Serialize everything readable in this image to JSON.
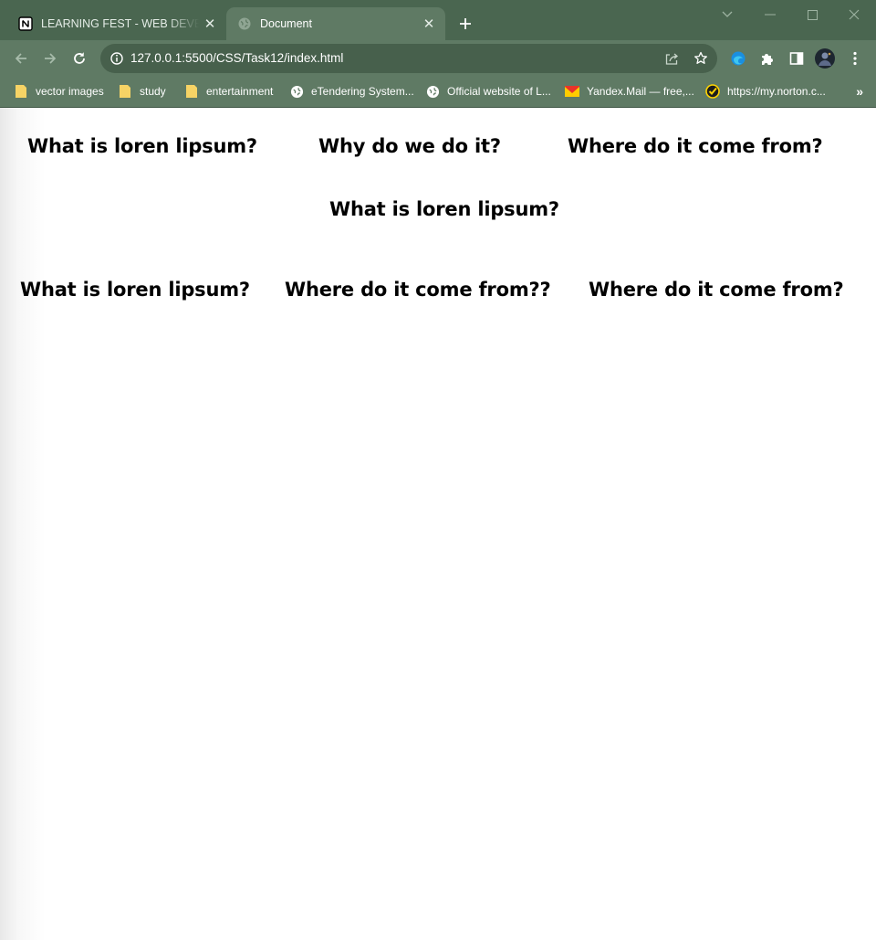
{
  "browser": {
    "tabs": [
      {
        "title": "LEARNING FEST - WEB DEVELOPMENT",
        "icon": "notion-icon",
        "active": false
      },
      {
        "title": "Document",
        "icon": "globe-icon",
        "active": true
      }
    ],
    "address": "127.0.0.1:5500/CSS/Task12/index.html",
    "bookmarks": [
      {
        "label": "vector images",
        "icon": "folder-icon"
      },
      {
        "label": "study",
        "icon": "folder-icon"
      },
      {
        "label": "entertainment",
        "icon": "folder-icon"
      },
      {
        "label": "eTendering System...",
        "icon": "globe-icon"
      },
      {
        "label": "Official website of L...",
        "icon": "globe-icon"
      },
      {
        "label": "Yandex.Mail — free,...",
        "icon": "mail-icon"
      },
      {
        "label": "https://my.norton.c...",
        "icon": "norton-icon"
      }
    ],
    "more_bookmarks": "»",
    "colors": {
      "frame": "#4a6650",
      "toolbar": "#5f7a64",
      "omnibox": "#47604c"
    }
  },
  "page": {
    "row1": [
      "What is loren lipsum?",
      "Why do we do it?",
      "Where do it come from?"
    ],
    "row2": [
      "What is loren lipsum?"
    ],
    "row3": [
      "What is loren lipsum?",
      "Where do it come from??",
      "Where do it come from?"
    ]
  }
}
